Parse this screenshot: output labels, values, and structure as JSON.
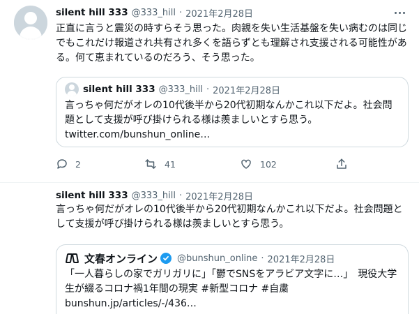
{
  "tweets": [
    {
      "display_name": "silent hill 333",
      "handle": "@333_hill",
      "sep": "·",
      "date": "2021年2月28日",
      "text": "正直に言うと震災の時すらそう思った。肉親を失い生活基盤を失い病むのは同じでもこれだけ報道され共有され多くを語らずとも理解され支援される可能性がある。何て恵まれているのだろう、そう思った。",
      "quote": {
        "display_name": "silent hill 333",
        "handle": "@333_hill",
        "sep": "·",
        "date": "2021年2月28日",
        "text": "言っちゃ何だがオレの10代後半から20代初期なんかこれ以下だよ。社会問題として支援が呼び掛けられる様は羨ましいとすら思う。",
        "link": "twitter.com/bunshun_online…"
      },
      "actions": {
        "reply_count": "2",
        "retweet_count": "41",
        "like_count": "102"
      }
    },
    {
      "display_name": "silent hill 333",
      "handle": "@333_hill",
      "sep": "·",
      "date": "2021年2月28日",
      "text": "言っちゃ何だがオレの10代後半から20代初期なんかこれ以下だよ。社会問題として支援が呼び掛けられる様は羨ましいとすら思う。",
      "quote": {
        "display_name": "文春オンライン",
        "handle": "@bunshun_online",
        "sep": "·",
        "date": "2021年2月28日",
        "text": "「一人暮らしの家でガリガリに」「鬱でSNSをアラビア文字に…」　現役大学生が綴るコロナ禍1年間の現実 #新型コロナ #自粛",
        "link": "bunshun.jp/articles/-/436…"
      }
    }
  ],
  "colors": {
    "text": "#0f1419",
    "secondary": "#536471",
    "border": "#cfd9de",
    "verified": "#1d9bf0"
  },
  "icons": [
    "more-icon",
    "reply-icon",
    "retweet-icon",
    "like-icon",
    "share-icon",
    "verified-icon",
    "bunshun-logo"
  ]
}
